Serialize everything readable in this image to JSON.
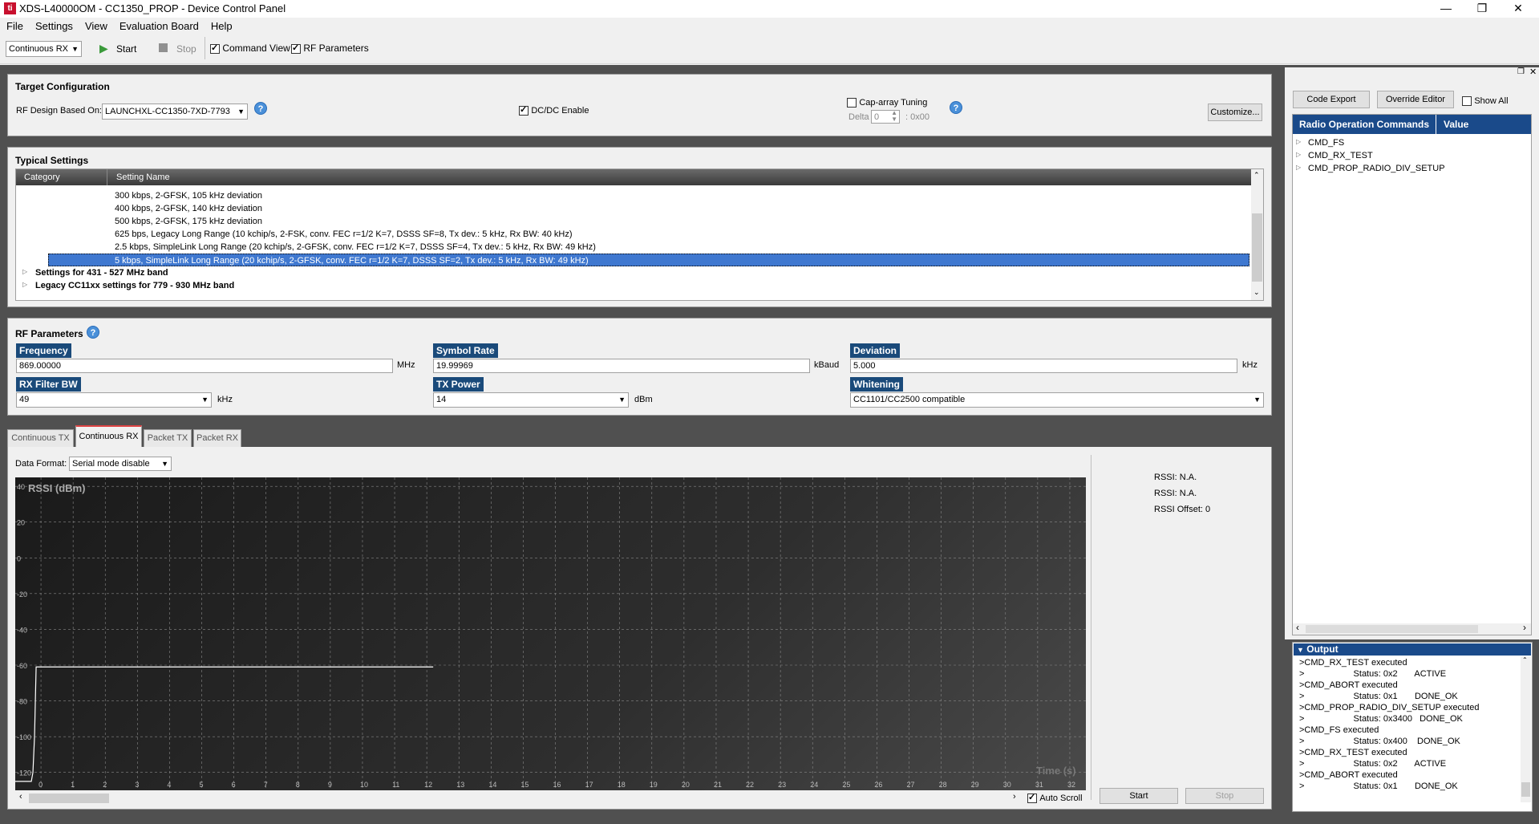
{
  "window": {
    "title": "XDS-L40000OM - CC1350_PROP - Device Control Panel",
    "icon_name": "ti-logo-icon",
    "minimize": "—",
    "restore": "❐",
    "close": "✕"
  },
  "menu": [
    "File",
    "Settings",
    "View",
    "Evaluation Board",
    "Help"
  ],
  "toolbar": {
    "mode_value": "Continuous RX",
    "start_label": "Start",
    "stop_label": "Stop",
    "command_view_label": "Command View",
    "rf_parameters_label": "RF Parameters"
  },
  "target_config": {
    "title": "Target Configuration",
    "rf_design_label": "RF Design Based On:",
    "rf_design_value": "LAUNCHXL-CC1350-7XD-7793",
    "dcdc_label": "DC/DC Enable",
    "cap_array_label": "Cap-array Tuning",
    "delta_label": "Delta",
    "delta_value": "0",
    "hex_value": ": 0x00",
    "customize_label": "Customize..."
  },
  "typical_settings": {
    "title": "Typical Settings",
    "col_category": "Category",
    "col_setting": "Setting Name",
    "rows": [
      "300 kbps, 2-GFSK, 105 kHz deviation",
      "400 kbps, 2-GFSK, 140 kHz deviation",
      "500 kbps, 2-GFSK, 175 kHz deviation",
      "625 bps, Legacy Long Range (10 kchip/s, 2-FSK, conv. FEC r=1/2 K=7, DSSS SF=8, Tx dev.: 5 kHz, Rx BW: 40 kHz)",
      "2.5 kbps, SimpleLink Long Range (20 kchip/s, 2-GFSK, conv. FEC r=1/2 K=7, DSSS SF=4, Tx dev.: 5 kHz, Rx BW: 49 kHz)",
      "5 kbps, SimpleLink Long Range (20 kchip/s, 2-GFSK, conv. FEC r=1/2 K=7, DSSS SF=2, Tx dev.: 5 kHz, Rx BW: 49 kHz)"
    ],
    "groups": [
      "Settings for 431 - 527 MHz band",
      "Legacy CC11xx settings for 779 - 930 MHz band"
    ]
  },
  "rf_params": {
    "title": "RF Parameters",
    "frequency_label": "Frequency",
    "frequency_value": "869.00000",
    "frequency_unit": "MHz",
    "symbol_rate_label": "Symbol Rate",
    "symbol_rate_value": "19.99969",
    "symbol_rate_unit": "kBaud",
    "deviation_label": "Deviation",
    "deviation_value": "5.000",
    "deviation_unit": "kHz",
    "rx_bw_label": "RX Filter BW",
    "rx_bw_value": "49",
    "rx_bw_unit": "kHz",
    "tx_power_label": "TX Power",
    "tx_power_value": "14",
    "tx_power_unit": "dBm",
    "whitening_label": "Whitening",
    "whitening_value": "CC1101/CC2500 compatible"
  },
  "tabs": [
    "Continuous TX",
    "Continuous RX",
    "Packet TX",
    "Packet RX"
  ],
  "rx_panel": {
    "data_format_label": "Data Format:",
    "data_format_value": "Serial mode disable",
    "rssi1": "RSSI: N.A.",
    "rssi2": "RSSI: N.A.",
    "rssi_offset": "RSSI Offset: 0",
    "start_label": "Start",
    "stop_label": "Stop",
    "auto_scroll_label": "Auto Scroll"
  },
  "chart_data": {
    "type": "line",
    "title": "RSSI (dBm)",
    "xlabel": "Time (s)",
    "ylabel": "RSSI (dBm)",
    "xlim": [
      -0.8,
      32.5
    ],
    "ylim": [
      -130,
      45
    ],
    "yticks": [
      40,
      20,
      0,
      -20,
      -40,
      -60,
      -80,
      -100,
      -120
    ],
    "xticks": [
      0,
      1,
      2,
      3,
      4,
      5,
      6,
      7,
      8,
      9,
      10,
      11,
      12,
      13,
      14,
      15,
      16,
      17,
      18,
      19,
      20,
      21,
      22,
      23,
      24,
      25,
      26,
      27,
      28,
      29,
      30,
      31,
      32
    ],
    "grid": true,
    "series": [
      {
        "x": [
          -0.8,
          -0.3,
          -0.25,
          -0.2,
          -0.15,
          12.2
        ],
        "y": [
          -125,
          -125,
          -120,
          -100,
          -61,
          -61
        ],
        "color": "#ffffff"
      }
    ]
  },
  "right_panel": {
    "code_export_label": "Code Export",
    "override_editor_label": "Override Editor",
    "show_all_label": "Show All",
    "col_commands": "Radio Operation Commands",
    "col_value": "Value",
    "commands": [
      "CMD_FS",
      "CMD_RX_TEST",
      "CMD_PROP_RADIO_DIV_SETUP"
    ],
    "output_title": "Output",
    "output_lines": [
      ">CMD_RX_TEST executed",
      ">                    Status: 0x2       ACTIVE",
      ">CMD_ABORT executed",
      ">                    Status: 0x1       DONE_OK",
      ">CMD_PROP_RADIO_DIV_SETUP executed",
      ">                    Status: 0x3400   DONE_OK",
      ">CMD_FS executed",
      ">                    Status: 0x400    DONE_OK",
      ">CMD_RX_TEST executed",
      ">                    Status: 0x2       ACTIVE",
      ">CMD_ABORT executed",
      ">                    Status: 0x1       DONE_OK"
    ]
  }
}
